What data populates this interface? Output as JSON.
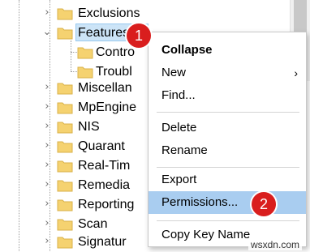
{
  "tree": {
    "items": [
      {
        "label": "Exclusions",
        "expanded": false
      },
      {
        "label": "Features",
        "expanded": true,
        "selected": true
      },
      {
        "label": "Contro",
        "child": true
      },
      {
        "label": "Troubl",
        "child": true
      },
      {
        "label": "Miscellan",
        "expanded": false
      },
      {
        "label": "MpEngine",
        "expanded": false
      },
      {
        "label": "NIS",
        "expanded": false
      },
      {
        "label": "Quarant",
        "expanded": false
      },
      {
        "label": "Real-Tim",
        "expanded": false
      },
      {
        "label": "Remedia",
        "expanded": false
      },
      {
        "label": "Reporting",
        "expanded": false
      },
      {
        "label": "Scan",
        "expanded": false
      },
      {
        "label": "Signatur",
        "expanded": false
      }
    ]
  },
  "context_menu": {
    "collapse": "Collapse",
    "new": "New",
    "find": "Find...",
    "delete": "Delete",
    "rename": "Rename",
    "export": "Export",
    "permissions": "Permissions...",
    "copy_key_name": "Copy Key Name"
  },
  "callouts": {
    "step1": "1",
    "step2": "2"
  },
  "watermark": "wsxdn.com",
  "colors": {
    "folder": "#f5d270",
    "selection": "#cce4f7",
    "menu_highlight": "#a9cdf0",
    "callout": "#d91e1e"
  }
}
